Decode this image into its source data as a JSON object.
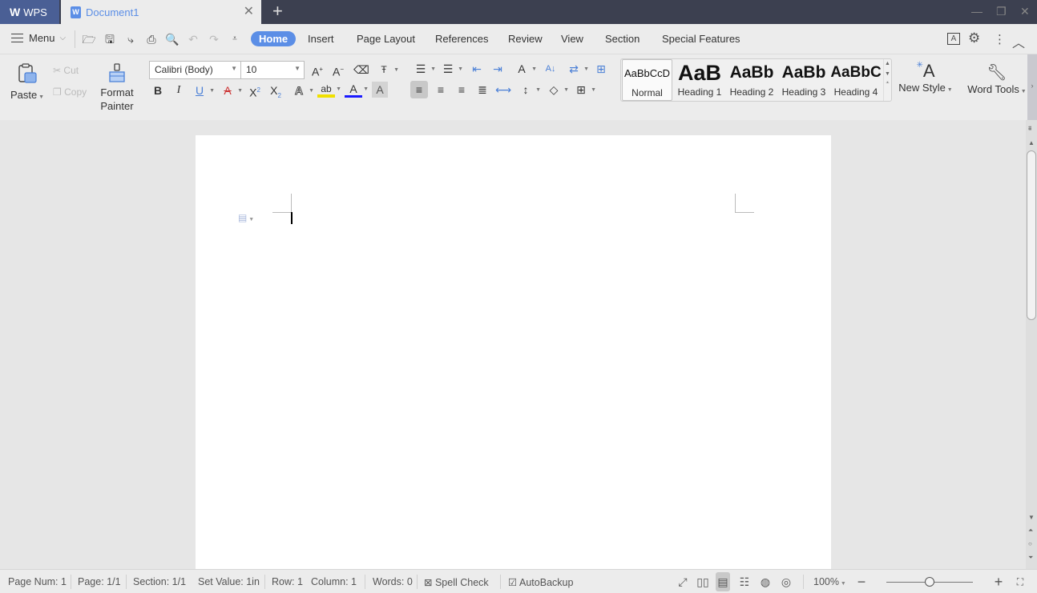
{
  "titlebar": {
    "app_name": "WPS",
    "document_tab": "Document1",
    "new_tab_icon": "+",
    "window_controls": [
      "minimize",
      "restore",
      "close"
    ]
  },
  "menubar": {
    "menu_label": "Menu",
    "quick_access": [
      "open-icon",
      "save-icon",
      "format-painter-quick-icon",
      "print-icon",
      "print-preview-icon",
      "undo-icon",
      "redo-icon",
      "customize-icon"
    ],
    "tabs": [
      {
        "label": "Home",
        "active": true
      },
      {
        "label": "Insert"
      },
      {
        "label": "Page Layout"
      },
      {
        "label": "References"
      },
      {
        "label": "Review"
      },
      {
        "label": "View"
      },
      {
        "label": "Section"
      },
      {
        "label": "Special Features"
      }
    ],
    "right_icons": [
      "reading-mode-icon",
      "settings-icon",
      "more-icon",
      "collapse-ribbon-icon"
    ]
  },
  "ribbon": {
    "paste": "Paste",
    "cut": "Cut",
    "copy": "Copy",
    "format_painter_line1": "Format",
    "format_painter_line2": "Painter",
    "font_name": "Calibri (Body)",
    "font_size": "10",
    "styles": [
      {
        "sample": "AaBbCcD",
        "label": "Normal",
        "selected": true
      },
      {
        "sample": "AaB",
        "label": "Heading 1"
      },
      {
        "sample": "AaBb",
        "label": "Heading 2"
      },
      {
        "sample": "AaBb",
        "label": "Heading 3"
      },
      {
        "sample": "AaBbC",
        "label": "Heading 4"
      }
    ],
    "new_style": "New Style",
    "word_tools": "Word Tools"
  },
  "statusbar": {
    "page_num": "Page Num: 1",
    "page": "Page: 1/1",
    "section": "Section: 1/1",
    "set_value": "Set Value: 1in",
    "row": "Row: 1",
    "column": "Column: 1",
    "words": "Words: 0",
    "spell_check": "Spell Check",
    "autobackup": "AutoBackup",
    "zoom": "100%",
    "zoom_fraction": 0.5
  },
  "colors": {
    "accent": "#5b8ee6",
    "titlebar": "#3c4050",
    "wps_tab": "#4a5f95",
    "highlight_yellow": "#f0e000",
    "font_color_blue": "#1a1aff"
  }
}
